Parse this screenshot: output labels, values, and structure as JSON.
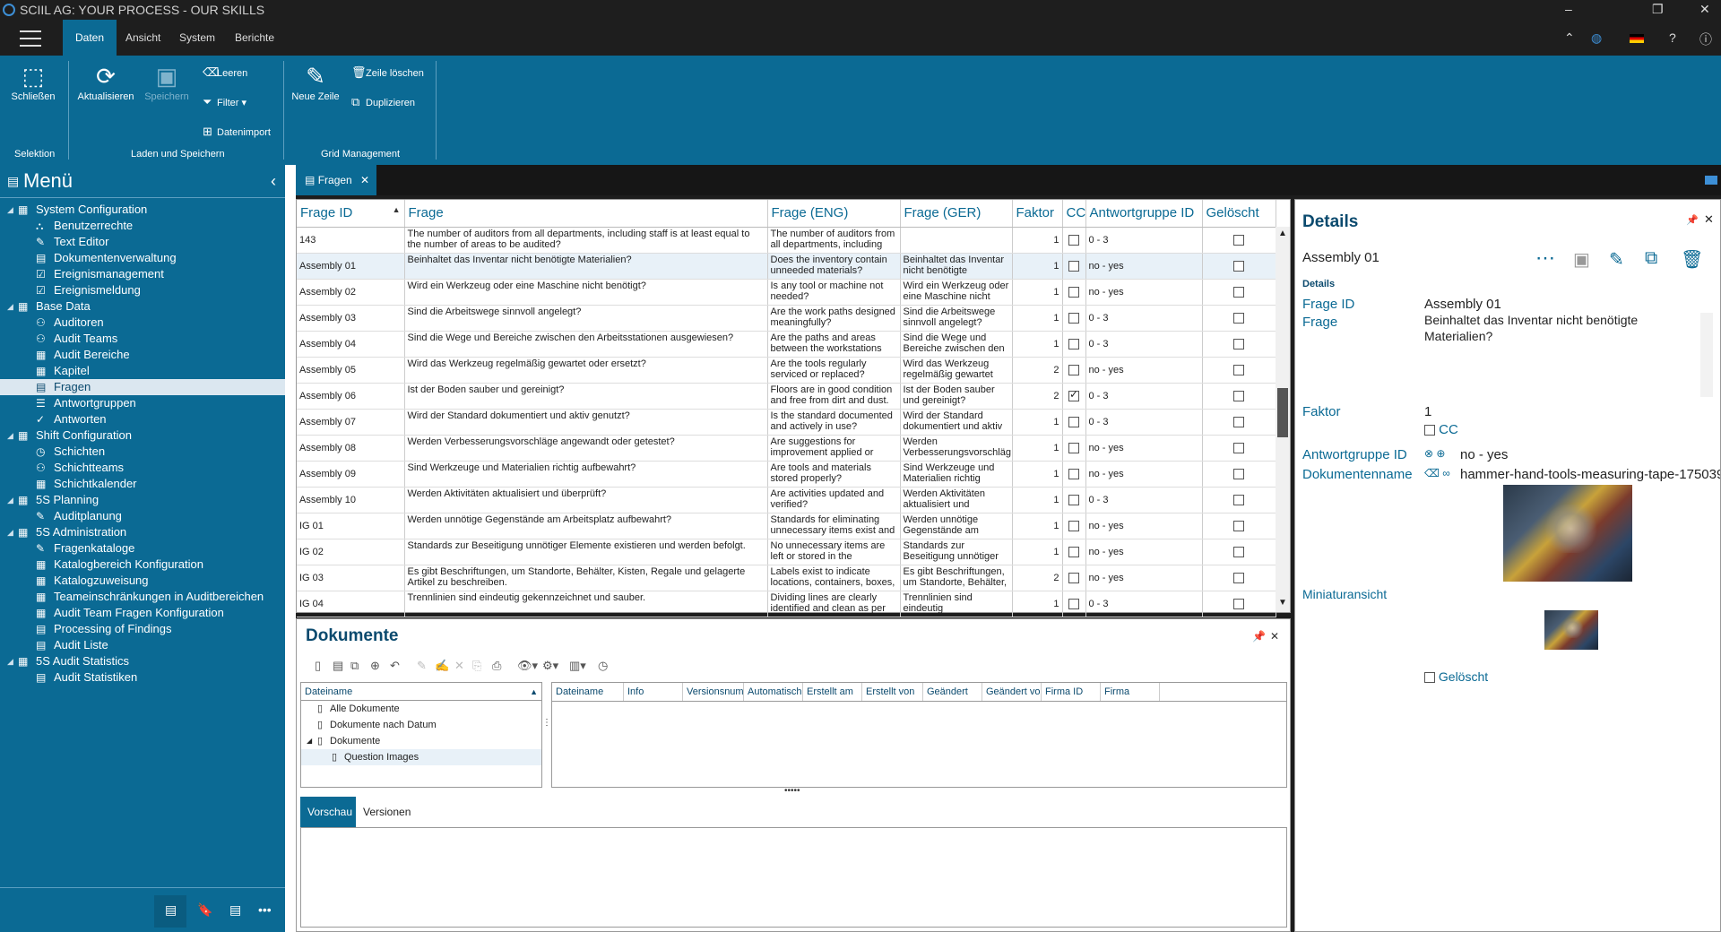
{
  "app": {
    "title": "SCIIL AG: YOUR PROCESS - OUR SKILLS"
  },
  "menu_tabs": [
    "Daten",
    "Ansicht",
    "System",
    "Berichte"
  ],
  "ribbon": {
    "selektion": {
      "schliessen": "Schließen",
      "group": "Selektion"
    },
    "laden": {
      "aktualisieren": "Aktualisieren",
      "speichern": "Speichern",
      "leeren": "Leeren",
      "filter": "Filter",
      "datenimport": "Datenimport",
      "group": "Laden und Speichern"
    },
    "grid": {
      "neue_zeile": "Neue Zeile",
      "zeile_loeschen": "Zeile löschen",
      "duplizieren": "Duplizieren",
      "group": "Grid Management"
    }
  },
  "sidebar": {
    "title": "Menü",
    "items": [
      {
        "label": "System Configuration",
        "level": 0,
        "icon": "folder-icon"
      },
      {
        "label": "Benutzerrechte",
        "level": 1,
        "icon": "users-icon"
      },
      {
        "label": "Text Editor",
        "level": 1,
        "icon": "edit-icon"
      },
      {
        "label": "Dokumentenverwaltung",
        "level": 1,
        "icon": "document-icon"
      },
      {
        "label": "Ereignismanagement",
        "level": 1,
        "icon": "checklist-icon"
      },
      {
        "label": "Ereignismeldung",
        "level": 1,
        "icon": "checklist-icon"
      },
      {
        "label": "Base Data",
        "level": 0,
        "icon": "folder-icon"
      },
      {
        "label": "Auditoren",
        "level": 1,
        "icon": "people-icon"
      },
      {
        "label": "Audit Teams",
        "level": 1,
        "icon": "people-icon"
      },
      {
        "label": "Audit Bereiche",
        "level": 1,
        "icon": "grid-icon"
      },
      {
        "label": "Kapitel",
        "level": 1,
        "icon": "grid-icon"
      },
      {
        "label": "Fragen",
        "level": 1,
        "icon": "document-icon",
        "selected": true
      },
      {
        "label": "Antwortgruppen",
        "level": 1,
        "icon": "list-icon"
      },
      {
        "label": "Antworten",
        "level": 1,
        "icon": "check-circle-icon"
      },
      {
        "label": "Shift Configuration",
        "level": 0,
        "icon": "folder-icon"
      },
      {
        "label": "Schichten",
        "level": 1,
        "icon": "clock-icon"
      },
      {
        "label": "Schichtteams",
        "level": 1,
        "icon": "people-icon"
      },
      {
        "label": "Schichtkalender",
        "level": 1,
        "icon": "calendar-icon"
      },
      {
        "label": "5S Planning",
        "level": 0,
        "icon": "folder-icon"
      },
      {
        "label": "Auditplanung",
        "level": 1,
        "icon": "edit-icon"
      },
      {
        "label": "5S Administration",
        "level": 0,
        "icon": "folder-icon"
      },
      {
        "label": "Fragenkataloge",
        "level": 1,
        "icon": "edit-icon"
      },
      {
        "label": "Katalogbereich Konfiguration",
        "level": 1,
        "icon": "grid-icon"
      },
      {
        "label": "Katalogzuweisung",
        "level": 1,
        "icon": "grid-icon"
      },
      {
        "label": "Teameinschränkungen in Auditbereichen",
        "level": 1,
        "icon": "grid-icon"
      },
      {
        "label": "Audit Team Fragen Konfiguration",
        "level": 1,
        "icon": "grid-icon"
      },
      {
        "label": "Processing of Findings",
        "level": 1,
        "icon": "document-icon"
      },
      {
        "label": "Audit Liste",
        "level": 1,
        "icon": "document-icon"
      },
      {
        "label": "5S Audit Statistics",
        "level": 0,
        "icon": "folder-icon"
      },
      {
        "label": "Audit Statistiken",
        "level": 1,
        "icon": "document-icon"
      }
    ]
  },
  "tab": {
    "label": "Fragen"
  },
  "grid": {
    "columns": [
      "Frage ID",
      "Frage",
      "Frage (ENG)",
      "Frage (GER)",
      "Faktor",
      "CC",
      "Antwortgruppe ID",
      "Gelöscht"
    ],
    "rows": [
      {
        "id": "143",
        "frage": "The number of auditors from all departments, including staff is at least equal to the number of areas to be audited?",
        "eng": "The number of auditors from all departments, including",
        "ger": "",
        "faktor": "1",
        "cc": false,
        "ag": "0 - 3",
        "del": false
      },
      {
        "id": "Assembly 01",
        "frage": "Beinhaltet das Inventar nicht benötigte Materialien?",
        "eng": "Does the inventory contain unneeded materials?",
        "ger": "Beinhaltet das Inventar nicht benötigte",
        "faktor": "1",
        "cc": false,
        "ag": "no - yes",
        "del": false,
        "selected": true
      },
      {
        "id": "Assembly 02",
        "frage": "Wird ein Werkzeug oder eine Maschine nicht benötigt?",
        "eng": "Is any tool or machine not needed?",
        "ger": "Wird ein Werkzeug oder eine Maschine nicht",
        "faktor": "1",
        "cc": false,
        "ag": "no - yes",
        "del": false
      },
      {
        "id": "Assembly 03",
        "frage": "Sind die Arbeitswege sinnvoll angelegt?",
        "eng": "Are the work paths designed meaningfully?",
        "ger": "Sind die Arbeitswege sinnvoll angelegt?",
        "faktor": "1",
        "cc": false,
        "ag": "0 - 3",
        "del": false
      },
      {
        "id": "Assembly 04",
        "frage": "Sind die Wege und Bereiche zwischen den Arbeitsstationen ausgewiesen?",
        "eng": "Are the paths and areas between the workstations",
        "ger": "Sind die Wege und Bereiche zwischen den",
        "faktor": "1",
        "cc": false,
        "ag": "0 - 3",
        "del": false
      },
      {
        "id": "Assembly 05",
        "frage": "Wird das Werkzeug regelmäßig gewartet oder ersetzt?",
        "eng": "Are the tools regularly serviced or replaced?",
        "ger": "Wird das Werkzeug regelmäßig gewartet",
        "faktor": "2",
        "cc": false,
        "ag": "no - yes",
        "del": false
      },
      {
        "id": "Assembly 06",
        "frage": "Ist der Boden sauber und gereinigt?",
        "eng": "Floors are in good condition and free from dirt and dust.",
        "ger": "Ist der Boden sauber und gereinigt?",
        "faktor": "2",
        "cc": true,
        "ag": "0 - 3",
        "del": false
      },
      {
        "id": "Assembly 07",
        "frage": "Wird der Standard dokumentiert und aktiv genutzt?",
        "eng": "Is the standard documented and actively in use?",
        "ger": "Wird der Standard dokumentiert und aktiv",
        "faktor": "1",
        "cc": false,
        "ag": "0 - 3",
        "del": false
      },
      {
        "id": "Assembly 08",
        "frage": "Werden Verbesserungsvorschläge angewandt oder getestet?",
        "eng": "Are suggestions for improvement applied or",
        "ger": "Werden Verbesserungsvorschläg",
        "faktor": "1",
        "cc": false,
        "ag": "no - yes",
        "del": false
      },
      {
        "id": "Assembly 09",
        "frage": "Sind Werkzeuge und Materialien richtig aufbewahrt?",
        "eng": "Are tools and materials stored properly?",
        "ger": "Sind Werkzeuge und Materialien richtig",
        "faktor": "1",
        "cc": false,
        "ag": "no - yes",
        "del": false
      },
      {
        "id": "Assembly 10",
        "frage": "Werden Aktivitäten aktualisiert und überprüft?",
        "eng": "Are activities updated and verified?",
        "ger": "Werden Aktivitäten aktualisiert und",
        "faktor": "1",
        "cc": false,
        "ag": "0 - 3",
        "del": false
      },
      {
        "id": "IG 01",
        "frage": "Werden unnötige Gegenstände am Arbeitsplatz aufbewahrt?",
        "eng": "Standards for eliminating unnecessary items exist and",
        "ger": "Werden unnötige Gegenstände am",
        "faktor": "1",
        "cc": false,
        "ag": "no - yes",
        "del": false
      },
      {
        "id": "IG 02",
        "frage": "Standards zur Beseitigung unnötiger Elemente existieren und werden befolgt.",
        "eng": "No unnecessary items are left or stored in the",
        "ger": "Standards zur Beseitigung unnötiger",
        "faktor": "1",
        "cc": false,
        "ag": "no - yes",
        "del": false
      },
      {
        "id": "IG 03",
        "frage": "Es gibt Beschriftungen, um Standorte, Behälter, Kisten, Regale und gelagerte Artikel zu beschreiben.",
        "eng": "Labels exist to indicate locations, containers, boxes,",
        "ger": "Es gibt Beschriftungen, um Standorte, Behälter,",
        "faktor": "2",
        "cc": false,
        "ag": "no - yes",
        "del": false
      },
      {
        "id": "IG 04",
        "frage": "Trennlinien sind eindeutig gekennzeichnet und sauber.",
        "eng": "Dividing lines are clearly identified and clean as per",
        "ger": "Trennlinien sind eindeutig",
        "faktor": "1",
        "cc": false,
        "ag": "0 - 3",
        "del": false
      }
    ]
  },
  "docs": {
    "title": "Dokumente",
    "tree_header": "Dateiname",
    "tree": [
      {
        "label": "Alle Dokumente",
        "indent": 1
      },
      {
        "label": "Dokumente nach Datum",
        "indent": 1
      },
      {
        "label": "Dokumente",
        "indent": 1,
        "expander": "◢"
      },
      {
        "label": "Question Images",
        "indent": 2,
        "selected": true
      }
    ],
    "file_columns": [
      "Dateiname",
      "Info",
      "Versionsnumme",
      "Automatische",
      "Erstellt am",
      "Erstellt von",
      "Geändert",
      "Geändert von",
      "Firma ID",
      "Firma"
    ],
    "preview_tabs": [
      "Vorschau",
      "Versionen"
    ]
  },
  "details": {
    "title": "Details",
    "record": "Assembly 01",
    "section": "Details",
    "frage_id_label": "Frage ID",
    "frage_id": "Assembly 01",
    "frage_label": "Frage",
    "frage": "Beinhaltet das Inventar nicht benötigte",
    "frage2": "Materialien?",
    "faktor_label": "Faktor",
    "faktor": "1",
    "cc_label": "CC",
    "ag_label": "Antwortgruppe ID",
    "ag": "no - yes",
    "dok_label": "Dokumentenname",
    "dok": "hammer-hand-tools-measuring-tape-175039",
    "mini_label": "Miniaturansicht",
    "geloescht_label": "Gelöscht"
  },
  "colors": {
    "accent": "#0b6a94",
    "dark": "#1e1e1e"
  }
}
